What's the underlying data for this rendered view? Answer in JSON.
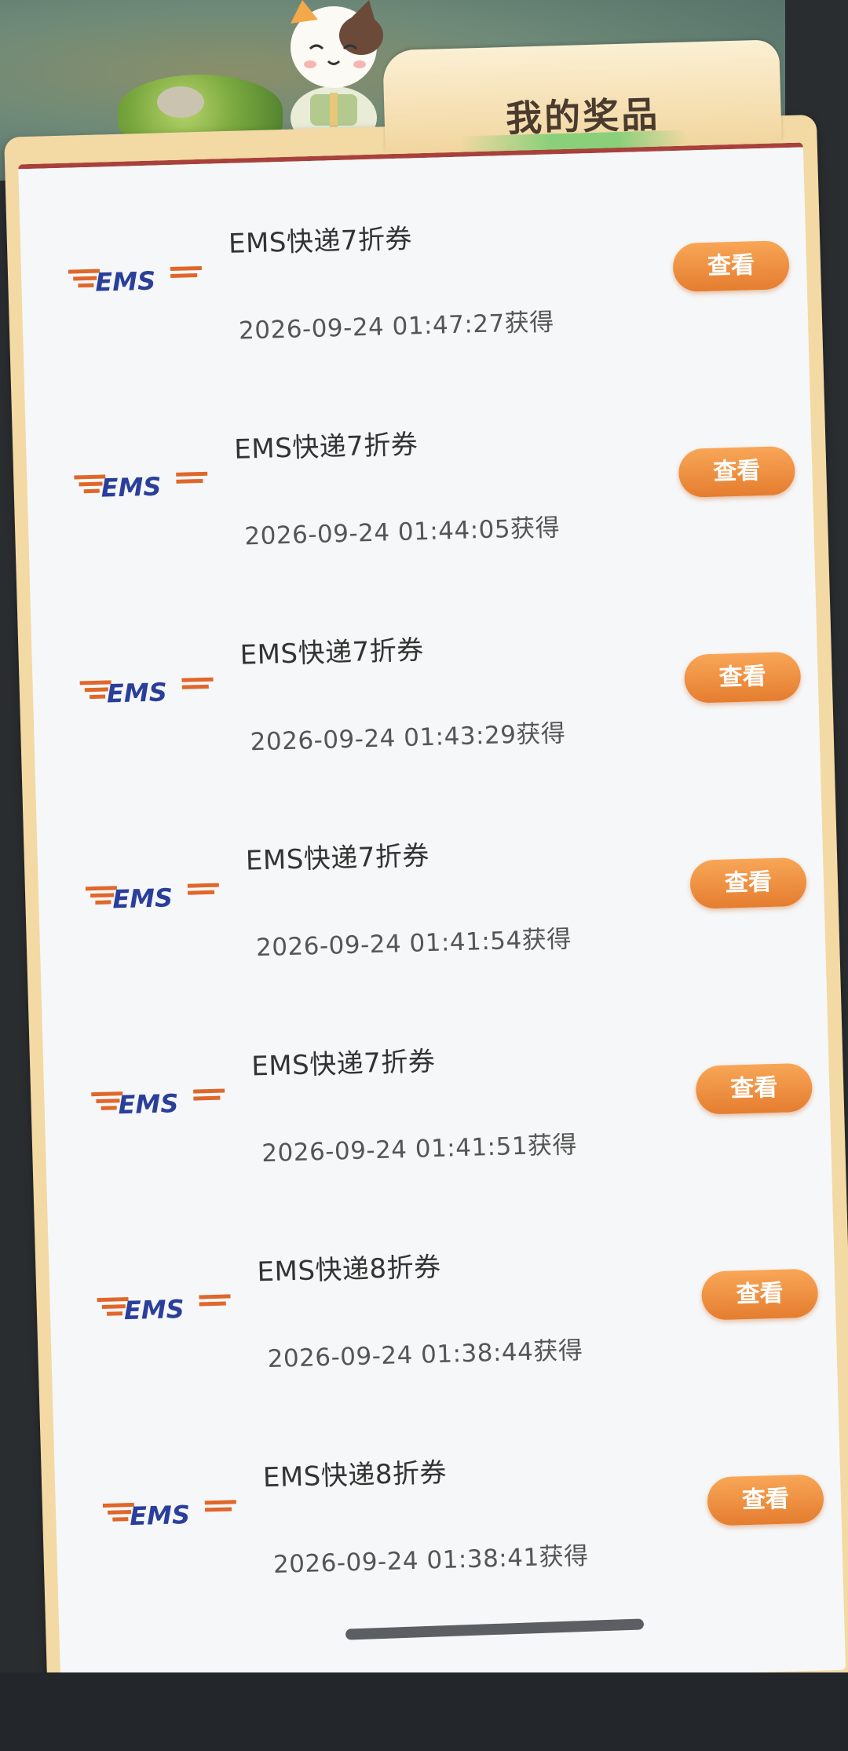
{
  "header": {
    "title": "我的奖品"
  },
  "prizes": [
    {
      "logo": "EMS",
      "name": "EMS快递7折券",
      "time": "2026-09-24 01:47:27获得",
      "action": "查看"
    },
    {
      "logo": "EMS",
      "name": "EMS快递7折券",
      "time": "2026-09-24 01:44:05获得",
      "action": "查看"
    },
    {
      "logo": "EMS",
      "name": "EMS快递7折券",
      "time": "2026-09-24 01:43:29获得",
      "action": "查看"
    },
    {
      "logo": "EMS",
      "name": "EMS快递7折券",
      "time": "2026-09-24 01:41:54获得",
      "action": "查看"
    },
    {
      "logo": "EMS",
      "name": "EMS快递7折券",
      "time": "2026-09-24 01:41:51获得",
      "action": "查看"
    },
    {
      "logo": "EMS",
      "name": "EMS快递8折券",
      "time": "2026-09-24 01:38:44获得",
      "action": "查看"
    },
    {
      "logo": "EMS",
      "name": "EMS快递8折券",
      "time": "2026-09-24 01:38:41获得",
      "action": "查看"
    }
  ],
  "colors": {
    "button": "#e57d2f",
    "ems_blue": "#2a3f9a",
    "ems_orange": "#e0672a",
    "card_border": "#a8413b"
  },
  "icons": {
    "mascot": "cat-mascot-icon",
    "logo": "ems-logo-icon"
  }
}
